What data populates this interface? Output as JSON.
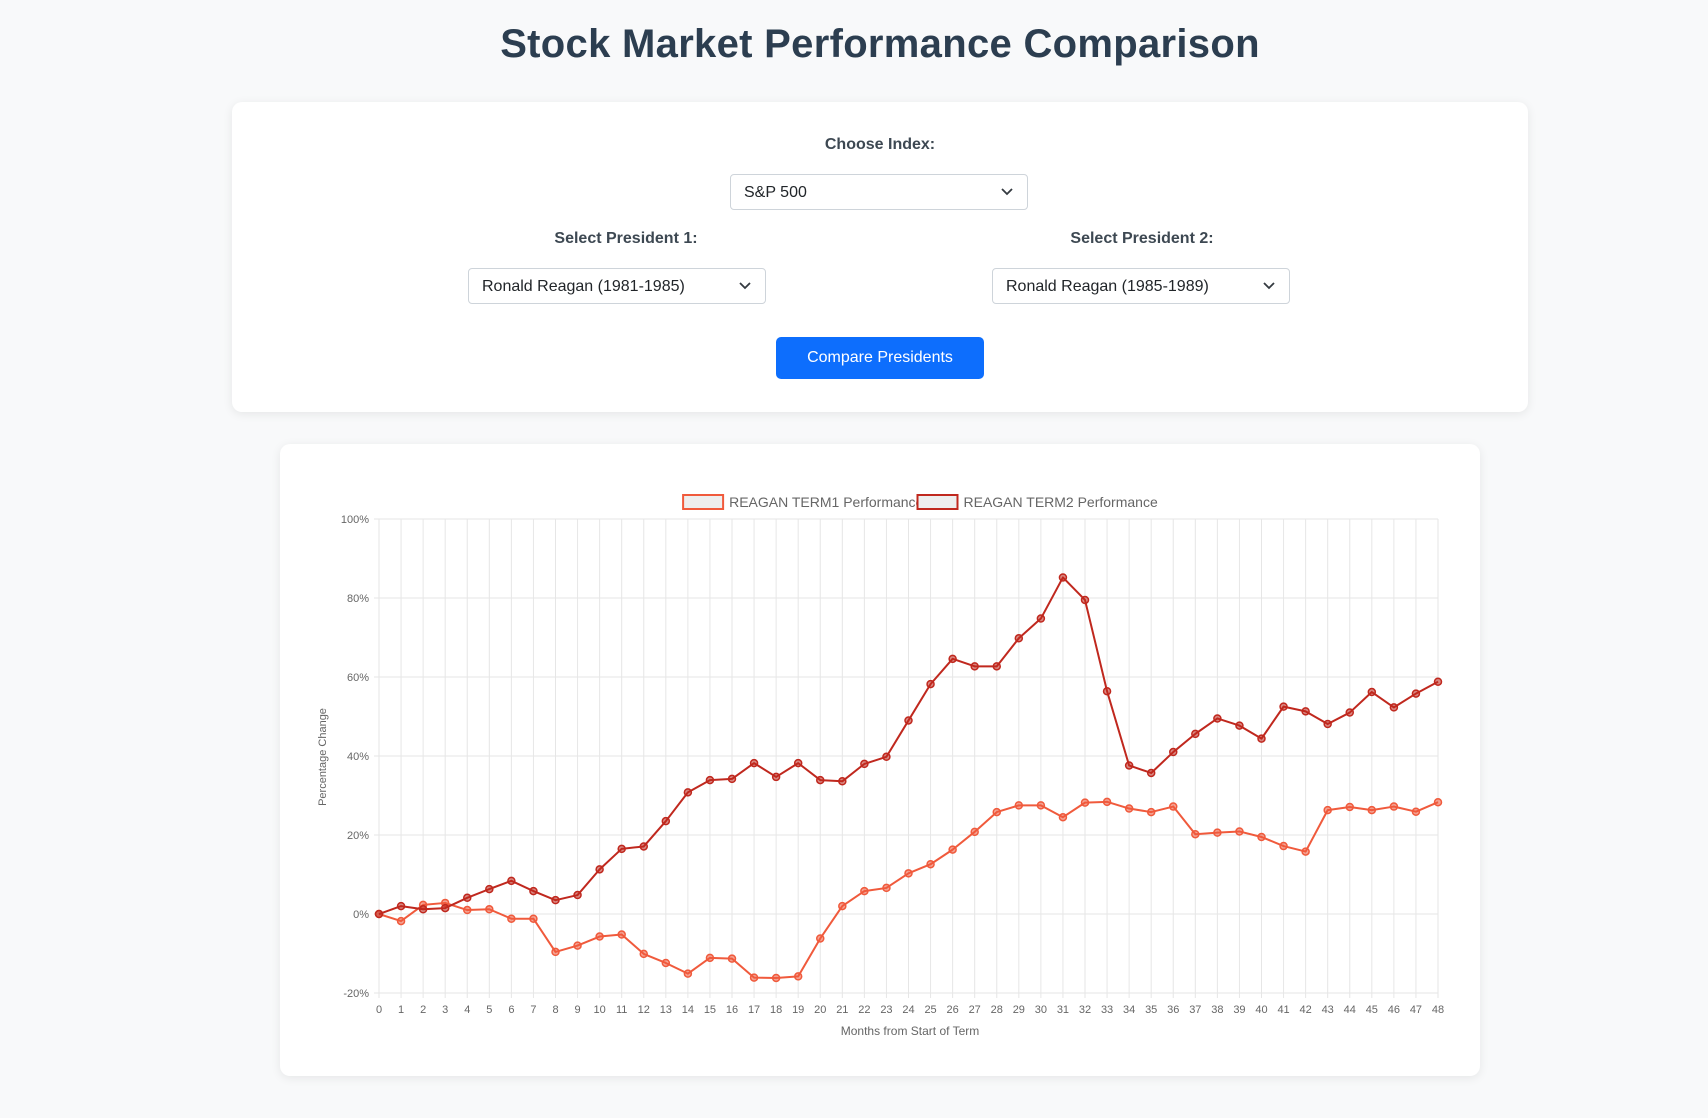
{
  "header": {
    "title": "Stock Market Performance Comparison"
  },
  "controls": {
    "index_label": "Choose Index:",
    "index_value": "S&P 500",
    "president1_label": "Select President 1:",
    "president1_value": "Ronald Reagan (1981-1985)",
    "president2_label": "Select President 2:",
    "president2_value": "Ronald Reagan (1985-1989)",
    "compare_button": "Compare Presidents",
    "button_color": "#0d6efd"
  },
  "chart_data": {
    "type": "line",
    "xlabel": "Months from Start of Term",
    "ylabel": "Percentage Change",
    "ylim": [
      -20,
      100
    ],
    "yticks": [
      -20,
      0,
      20,
      40,
      60,
      80,
      100
    ],
    "ytick_labels": [
      "-20%",
      "0%",
      "20%",
      "40%",
      "60%",
      "80%",
      "100%"
    ],
    "grid": true,
    "legend_position": "top-center",
    "x": [
      0,
      1,
      2,
      3,
      4,
      5,
      6,
      7,
      8,
      9,
      10,
      11,
      12,
      13,
      14,
      15,
      16,
      17,
      18,
      19,
      20,
      21,
      22,
      23,
      24,
      25,
      26,
      27,
      28,
      29,
      30,
      31,
      32,
      33,
      34,
      35,
      36,
      37,
      38,
      39,
      40,
      41,
      42,
      43,
      44,
      45,
      46,
      47,
      48
    ],
    "series": [
      {
        "name": "REAGAN TERM1 Performance",
        "color": "#f05a3c",
        "values": [
          0,
          -1.8,
          2.3,
          2.8,
          1.0,
          1.2,
          -1.2,
          -1.2,
          -9.6,
          -8.0,
          -5.7,
          -5.2,
          -10.1,
          -12.4,
          -15.1,
          -11.1,
          -11.3,
          -16.1,
          -16.2,
          -15.8,
          -6.2,
          2.0,
          5.8,
          6.6,
          10.3,
          12.6,
          16.3,
          20.8,
          25.8,
          27.5,
          27.5,
          24.5,
          28.2,
          28.4,
          26.7,
          25.8,
          27.2,
          20.2,
          20.6,
          20.9,
          19.5,
          17.2,
          15.8,
          26.3,
          27.1,
          26.3,
          27.2,
          25.9,
          28.3
        ]
      },
      {
        "name": "REAGAN TERM2 Performance",
        "color": "#c0281e",
        "values": [
          0,
          2.0,
          1.2,
          1.5,
          4.1,
          6.3,
          8.4,
          5.8,
          3.5,
          4.8,
          11.3,
          16.5,
          17.1,
          23.5,
          30.8,
          33.9,
          34.2,
          38.2,
          34.7,
          38.2,
          33.9,
          33.6,
          38.0,
          39.8,
          49.0,
          58.2,
          64.6,
          62.7,
          62.7,
          69.8,
          74.8,
          85.2,
          79.5,
          56.4,
          37.6,
          35.7,
          41.0,
          45.6,
          49.5,
          47.7,
          44.4,
          52.5,
          51.3,
          48.1,
          51.0,
          56.2,
          52.3,
          55.8,
          58.8
        ]
      }
    ]
  }
}
